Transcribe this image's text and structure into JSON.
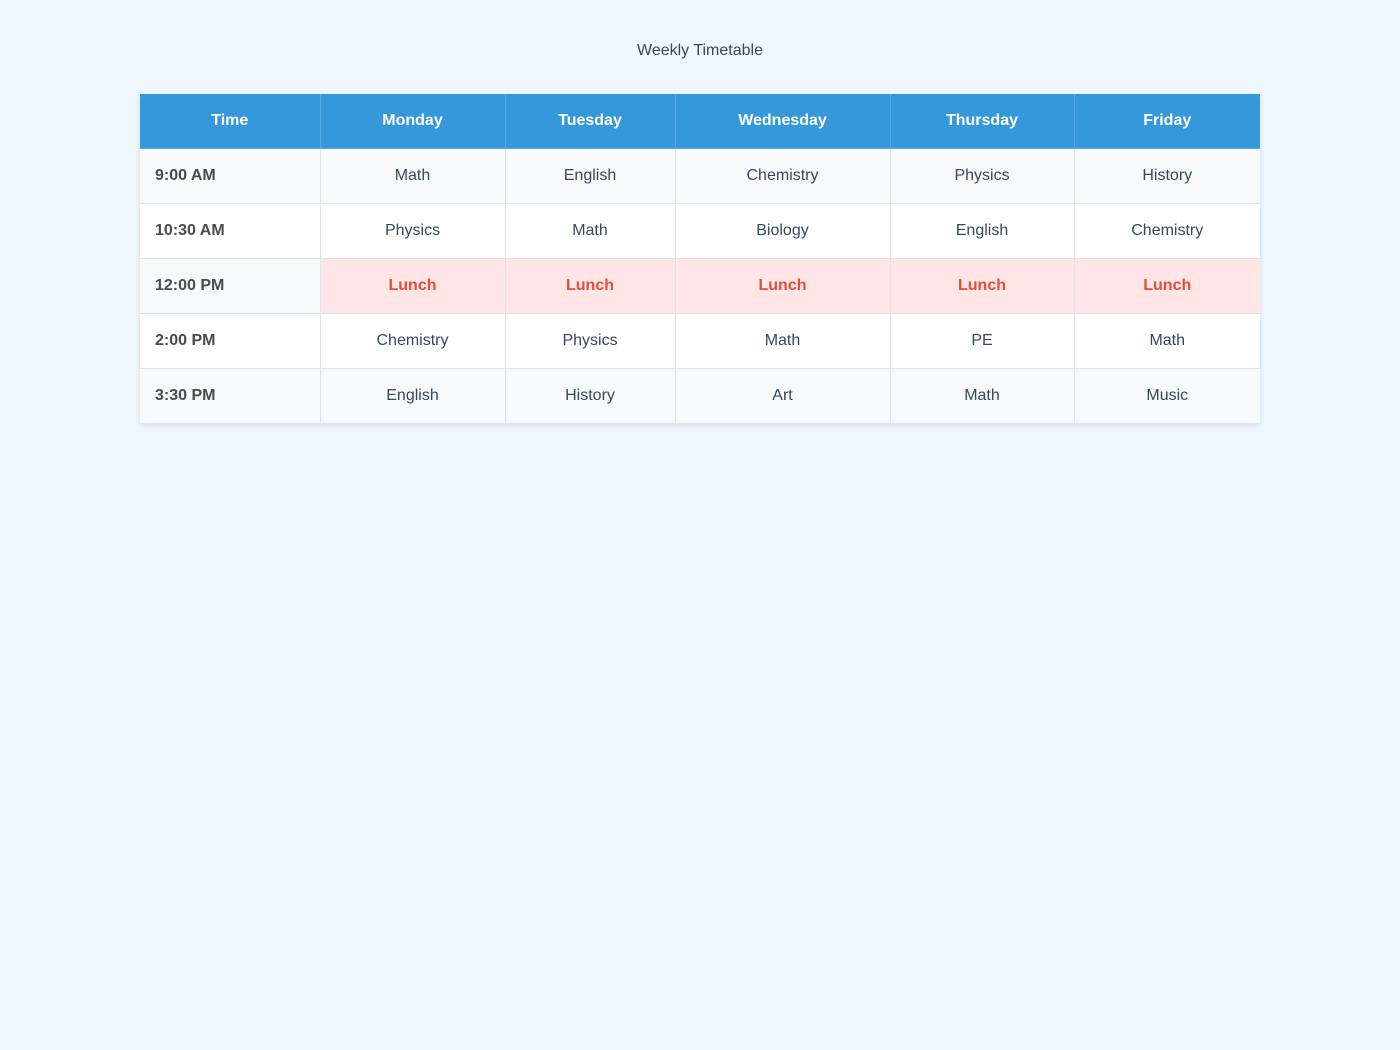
{
  "page": {
    "title": "Weekly Timetable"
  },
  "colors": {
    "background": "#f0f8ff",
    "header_bg": "#3498db",
    "header_text": "#ffffff",
    "lunch_bg": "#ffe6e6",
    "lunch_text": "#e74c3c"
  },
  "timetable": {
    "columns": [
      "Time",
      "Monday",
      "Tuesday",
      "Wednesday",
      "Thursday",
      "Friday"
    ],
    "rows": [
      {
        "time": "9:00 AM",
        "cells": [
          "Math",
          "English",
          "Chemistry",
          "Physics",
          "History"
        ],
        "lunch": false
      },
      {
        "time": "10:30 AM",
        "cells": [
          "Physics",
          "Math",
          "Biology",
          "English",
          "Chemistry"
        ],
        "lunch": false
      },
      {
        "time": "12:00 PM",
        "cells": [
          "Lunch",
          "Lunch",
          "Lunch",
          "Lunch",
          "Lunch"
        ],
        "lunch": true
      },
      {
        "time": "2:00 PM",
        "cells": [
          "Chemistry",
          "Physics",
          "Math",
          "PE",
          "Math"
        ],
        "lunch": false
      },
      {
        "time": "3:30 PM",
        "cells": [
          "English",
          "History",
          "Art",
          "Math",
          "Music"
        ],
        "lunch": false
      }
    ]
  }
}
